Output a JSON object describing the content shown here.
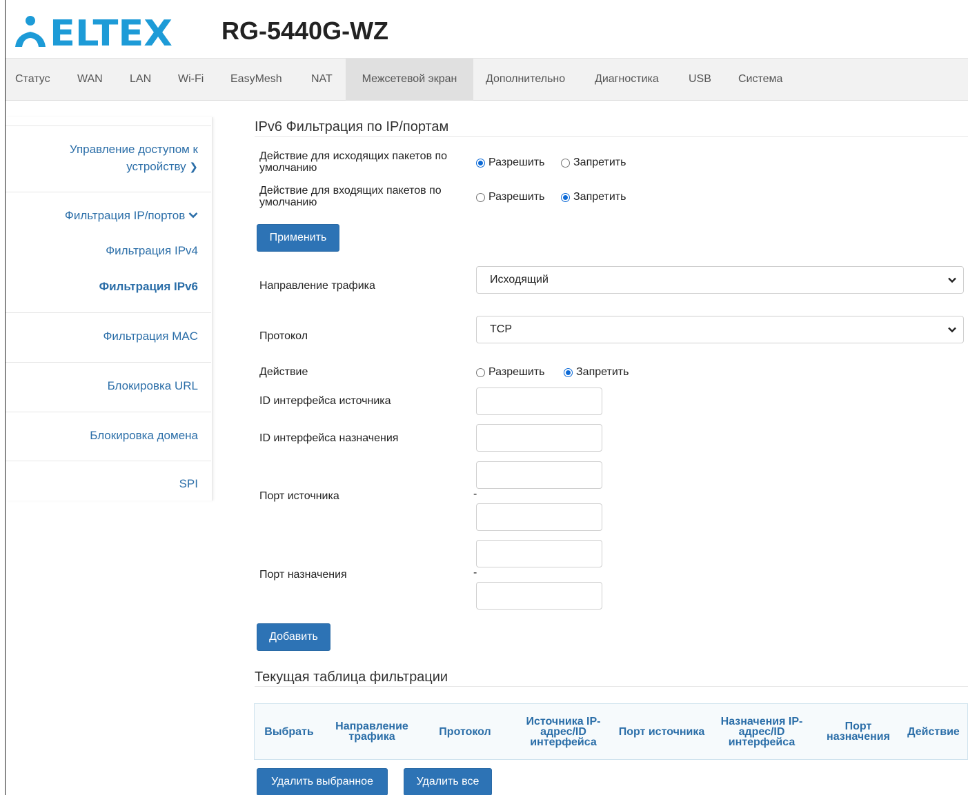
{
  "brand": {
    "logo_text": "ELTEX",
    "model": "RG-5440G-WZ",
    "accent": "#2b6ea8",
    "logo_color": "#1d9bd7"
  },
  "nav": {
    "items": [
      {
        "label": "Статус"
      },
      {
        "label": "WAN"
      },
      {
        "label": "LAN"
      },
      {
        "label": "Wi-Fi"
      },
      {
        "label": "EasyMesh"
      },
      {
        "label": "NAT"
      },
      {
        "label": "Межсетевой экран"
      },
      {
        "label": "Дополнительно"
      },
      {
        "label": "Диагностика"
      },
      {
        "label": "USB"
      },
      {
        "label": "Система"
      }
    ],
    "active": "Межсетевой экран"
  },
  "sidebar": {
    "access_line1": "Управление доступом к",
    "access_line2": "устройству",
    "ipfilter": "Фильтрация IP/портов",
    "ipv4": "Фильтрация IPv4",
    "ipv6": "Фильтрация IPv6",
    "mac": "Фильтрация MAC",
    "url": "Блокировка URL",
    "domain": "Блокировка домена",
    "spi": "SPI"
  },
  "main": {
    "title": "IPv6 Фильтрация по IP/портам",
    "outgoing_default_line1": "Действие для исходящих пакетов по",
    "outgoing_default_line2": "умолчанию",
    "incoming_default_line1": "Действие для входящих пакетов по",
    "incoming_default_line2": "умолчанию",
    "allow": "Разрешить",
    "deny": "Запретить",
    "outgoing_selected": "allow",
    "incoming_selected": "deny",
    "apply": "Применить",
    "direction_label": "Направление трафика",
    "direction_value": "Исходящий",
    "protocol_label": "Протокол",
    "protocol_value": "TCP",
    "action_label": "Действие",
    "action_selected": "deny",
    "src_iface_label": "ID интерфейса источника",
    "dst_iface_label": "ID интерфейса назначения",
    "src_port_label": "Порт источника",
    "dst_port_label": "Порт назначения",
    "range_sep": "-",
    "add": "Добавить"
  },
  "table": {
    "title": "Текущая таблица фильтрации",
    "headers": {
      "select": "Выбрать",
      "direction": "Направление трафика",
      "protocol": "Протокол",
      "src_ip": "Источника IP-адрес/ID интерфейса",
      "src_port": "Порт источника",
      "dst_ip": "Назначения IP-адрес/ID интерфейса",
      "dst_port": "Порт назначения",
      "action": "Действие"
    },
    "delete_selected": "Удалить выбранное",
    "delete_all": "Удалить все"
  }
}
